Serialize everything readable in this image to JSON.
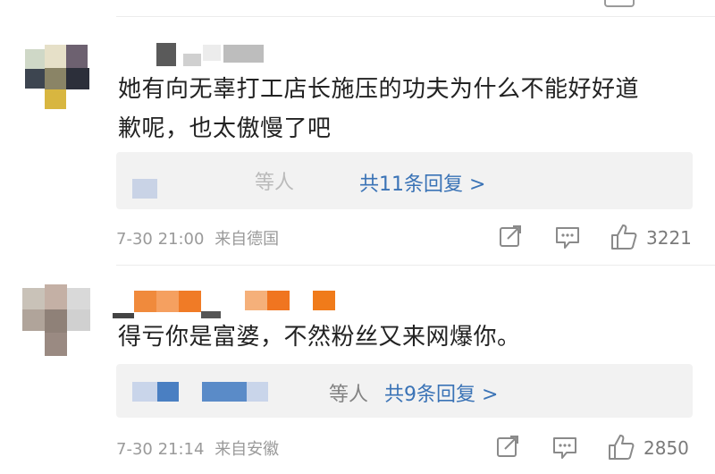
{
  "comments": [
    {
      "text_line1": "她有向无辜打工店长施压的功夫为什么不能好好道",
      "text_line2": "歉呢，也太傲慢了吧",
      "reply_blurred": "等人",
      "reply_link": "共11条回复 >",
      "timestamp": "7-30 21:00",
      "source": "来自德国",
      "likes": "3221"
    },
    {
      "text_line1": "得亏你是富婆，不然粉丝又来网爆你。",
      "reply_blurred": "等人",
      "reply_link": "共9条回复 >",
      "timestamp": "7-30 21:14",
      "source": "来自安徽",
      "likes": "2850"
    }
  ],
  "icons": {
    "share": "share-icon",
    "comment": "comment-icon",
    "like": "thumbs-up-icon"
  }
}
